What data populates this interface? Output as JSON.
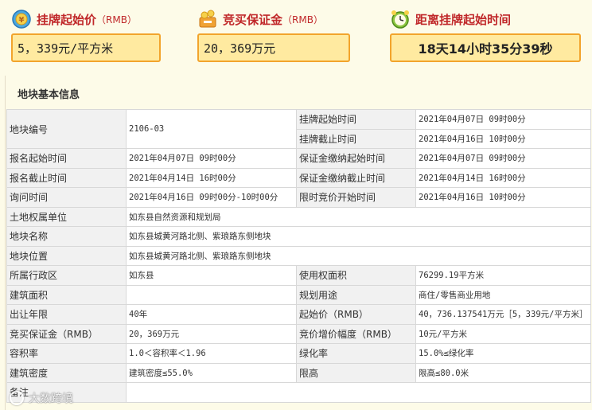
{
  "summary": {
    "start_price": {
      "label": "挂牌起始价",
      "unit": "（RMB）",
      "value": "5，339元/平方米",
      "icon": "price-coin-icon"
    },
    "deposit": {
      "label": "竞买保证金",
      "unit": "（RMB）",
      "value": "20，369万元",
      "icon": "deposit-icon"
    },
    "countdown": {
      "label": "距离挂牌起始时间",
      "value": "18天14小时35分39秒",
      "icon": "alarm-clock-icon"
    }
  },
  "section_title": "地块基本信息",
  "rows": [
    {
      "c1": "地块编号",
      "c2": "2106-03",
      "c3": "挂牌起始时间",
      "c4": "2021年04月07日 09时00分"
    },
    {
      "c3": "挂牌截止时间",
      "c4": "2021年04月16日 10时00分"
    },
    {
      "c1": "报名起始时间",
      "c2": "2021年04月07日 09时00分",
      "c3": "保证金缴纳起始时间",
      "c4": "2021年04月07日 09时00分"
    },
    {
      "c1": "报名截止时间",
      "c2": "2021年04月14日 16时00分",
      "c3": "保证金缴纳截止时间",
      "c4": "2021年04月14日 16时00分"
    },
    {
      "c1": "询问时间",
      "c2": "2021年04月16日 09时00分-10时00分",
      "c3": "限时竞价开始时间",
      "c4": "2021年04月16日 10时00分"
    },
    {
      "c1": "土地权属单位",
      "c2": "如东县自然资源和规划局"
    },
    {
      "c1": "地块名称",
      "c2": "如东县城黄河路北侧、紫琅路东侧地块"
    },
    {
      "c1": "地块位置",
      "c2": "如东县城黄河路北侧、紫琅路东侧地块"
    },
    {
      "c1": "所属行政区",
      "c2": "如东县",
      "c3": "使用权面积",
      "c4": "76299.19平方米"
    },
    {
      "c1": "建筑面积",
      "c2": "",
      "c3": "规划用途",
      "c4": "商住/零售商业用地"
    },
    {
      "c1": "出让年限",
      "c2": "40年",
      "c3": "起始价（RMB）",
      "c4": "40，736.137541万元［5，339元/平方米］"
    },
    {
      "c1": "竞买保证金（RMB）",
      "c2": "20，369万元",
      "c3": "竞价增价幅度（RMB）",
      "c4": "10元/平方米"
    },
    {
      "c1": "容积率",
      "c2": "1.0＜容积率＜1.96",
      "c3": "绿化率",
      "c4": "15.0%≤绿化率"
    },
    {
      "c1": "建筑密度",
      "c2": "建筑密度≤55.0%",
      "c3": "限高",
      "c4": "限高≤80.0米"
    },
    {
      "c1": "备注",
      "c2": ""
    }
  ],
  "watermark": "大数跨境",
  "colors": {
    "accent_red": "#c0282a",
    "box_fill": "#ffeaa0",
    "box_border": "#f2a42c",
    "page_bg": "#fdfbe8"
  }
}
